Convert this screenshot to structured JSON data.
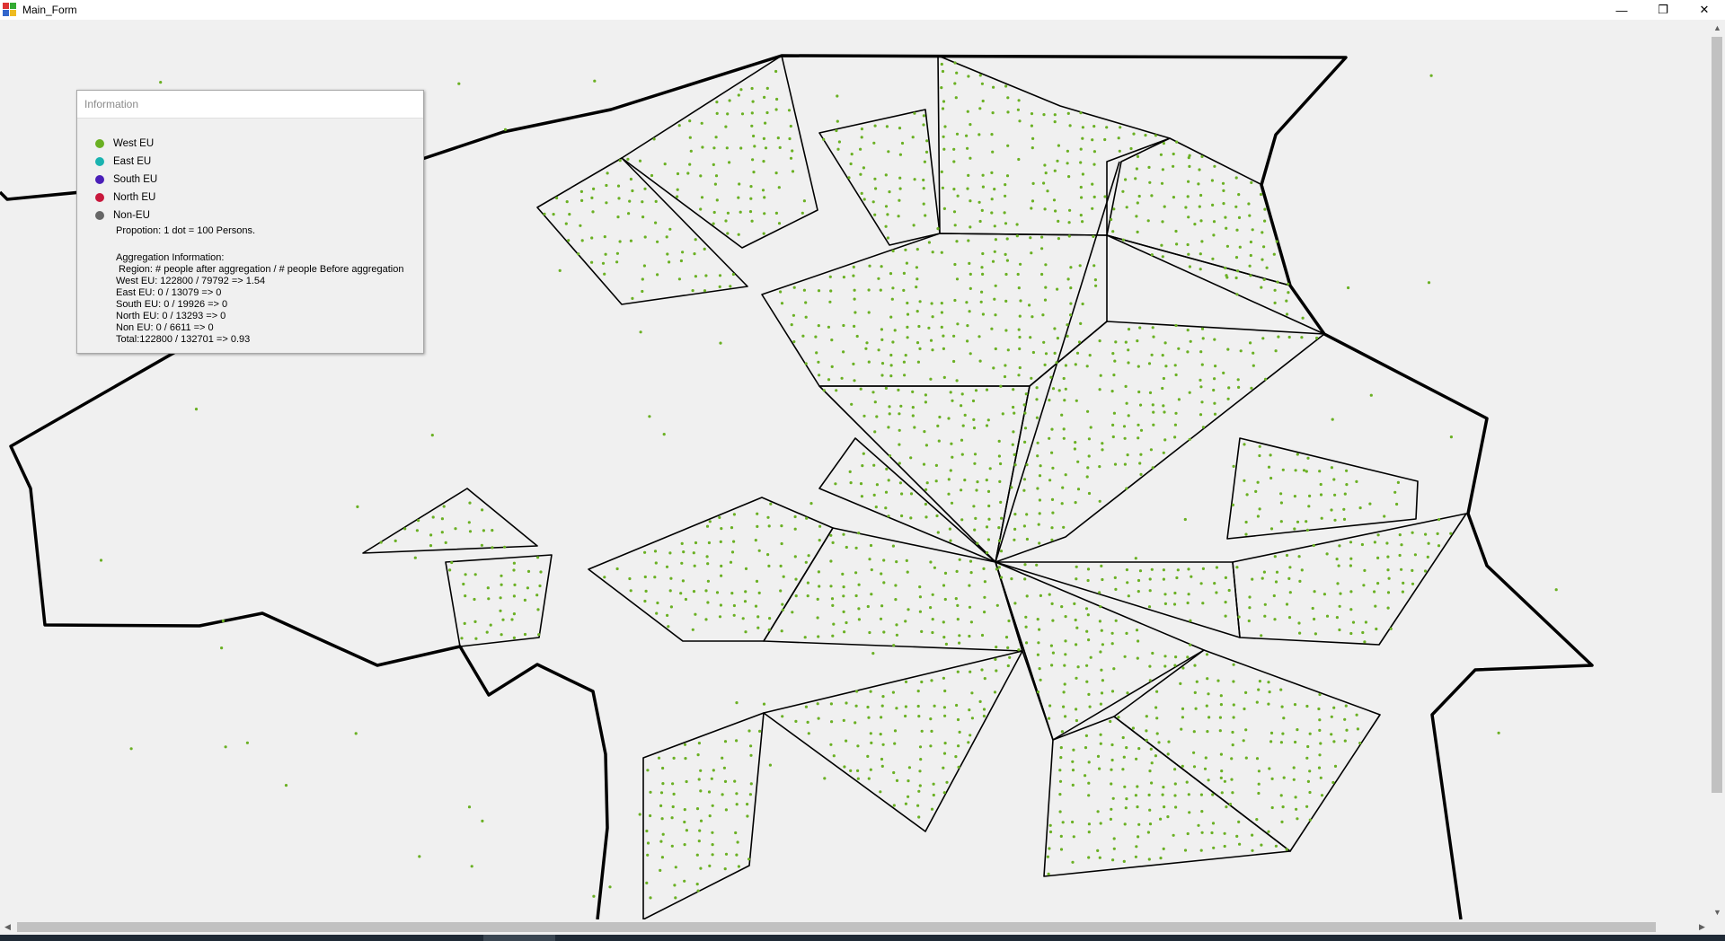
{
  "window": {
    "title": "Main_Form",
    "controls": {
      "minimize": "—",
      "restore": "❐",
      "close": "✕"
    }
  },
  "info_panel": {
    "header": "Information",
    "legend": [
      {
        "label": "West EU",
        "color": "#6ab023"
      },
      {
        "label": "East EU",
        "color": "#1ab3b0"
      },
      {
        "label": "South EU",
        "color": "#4a1fb8"
      },
      {
        "label": "North EU",
        "color": "#c8183c"
      },
      {
        "label": "Non-EU",
        "color": "#666666"
      }
    ],
    "proportion": "Propotion: 1 dot = 100 Persons.",
    "aggregation_title": "Aggregation Information:",
    "aggregation_lines": [
      " Region: # people after aggregation / # people Before aggregation",
      "West EU: 122800 / 79792 => 1.54",
      "East EU: 0 / 13079 => 0",
      "South EU: 0 / 19926 => 0",
      "North EU: 0 / 13293 => 0",
      "Non EU: 0 / 6611 => 0",
      "Total:122800 / 132701 => 0.93"
    ]
  },
  "map": {
    "dot_color": "#6ab023",
    "line_color": "#000000"
  },
  "scrollbars": {
    "up_arrow": "▲",
    "down_arrow": "▼",
    "left_arrow": "◀",
    "right_arrow": "▶"
  }
}
